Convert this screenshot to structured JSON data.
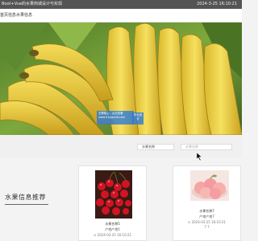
{
  "topbar": {
    "title": "Boot+Vue的水果商城设计与实现",
    "datetime": "2024-3-25 16:10:21"
  },
  "nav": {
    "home": "首页信息",
    "items": [
      "水果信息"
    ]
  },
  "hero": {
    "watermark_text": "无需核心，点击查看",
    "watermark_url": "www.51ogonid.com",
    "watermark_badge": "毕业设计"
  },
  "search": {
    "select_value": "水果名称",
    "input_placeholder": "水果名称"
  },
  "section": {
    "title": "水果信息推荐"
  },
  "cards": [
    {
      "name": "水果名称5",
      "stock": "产地产地5",
      "date": "2024-03-25 16:10:21",
      "image": "cherries"
    },
    {
      "name": "水果名称7",
      "stock": "产地产地7",
      "date": "2024-03-25 16:10:21",
      "stats": "7 7",
      "image": "peaches"
    }
  ],
  "colors": {
    "topbar": "#545454",
    "banana": "#f0d84a",
    "leaf": "#6f9a3a",
    "watermark": "#2878dc"
  }
}
